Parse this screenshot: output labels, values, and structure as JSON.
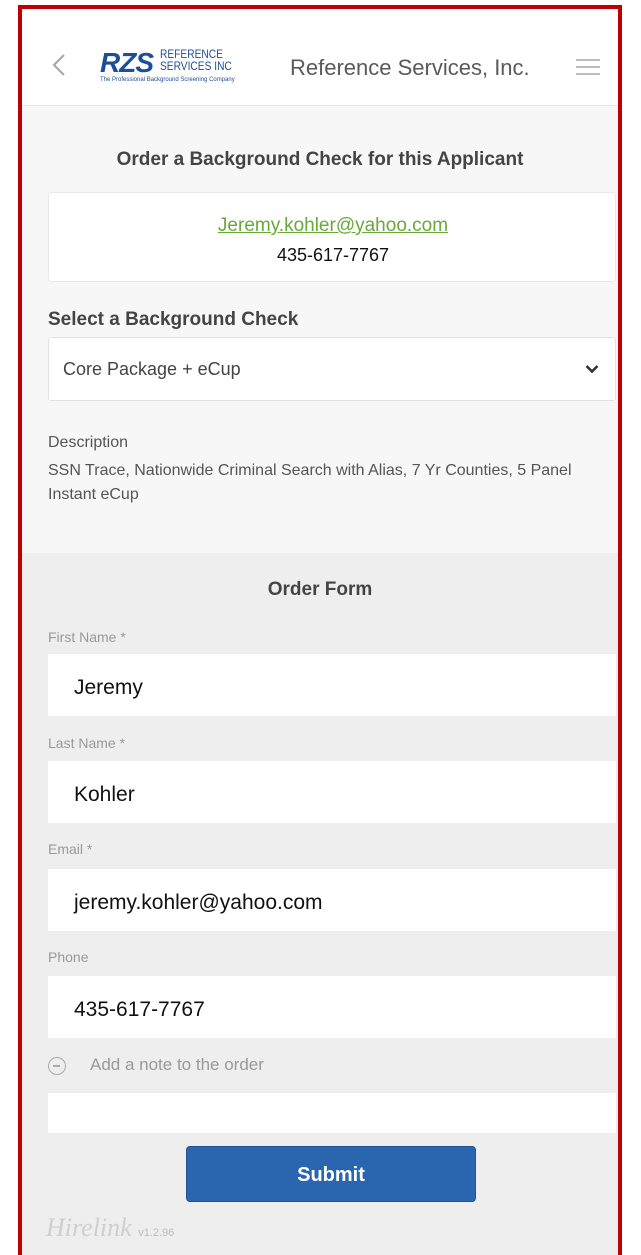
{
  "header": {
    "logo_mark": "RZS",
    "logo_line1": "REFERENCE",
    "logo_line2": "SERVICES INC",
    "logo_tagline": "The Professional Background Screening Company",
    "title": "Reference Services, Inc."
  },
  "applicant": {
    "heading": "Order a Background Check for this Applicant",
    "email": "Jeremy.kohler@yahoo.com",
    "phone": "435-617-7767"
  },
  "background_check": {
    "label": "Select a Background Check",
    "selected": "Core Package + eCup",
    "description_label": "Description",
    "description": "SSN Trace, Nationwide Criminal Search with Alias, 7 Yr Counties, 5 Panel Instant eCup"
  },
  "order_form": {
    "heading": "Order Form",
    "first_name_label": "First Name *",
    "first_name_value": "Jeremy",
    "last_name_label": "Last Name *",
    "last_name_value": "Kohler",
    "email_label": "Email *",
    "email_value": "jeremy.kohler@yahoo.com",
    "phone_label": "Phone",
    "phone_value": "435-617-7767",
    "note_label": "Add a note to the order",
    "submit_label": "Submit"
  },
  "footer": {
    "brand": "Hirelink",
    "version": "v1.2.96"
  },
  "colors": {
    "frame_border": "#c00000",
    "link_green": "#6aa83a",
    "submit_blue": "#2a66b0",
    "brand_blue": "#1c4f97",
    "brand_orange": "#e98b1c"
  }
}
